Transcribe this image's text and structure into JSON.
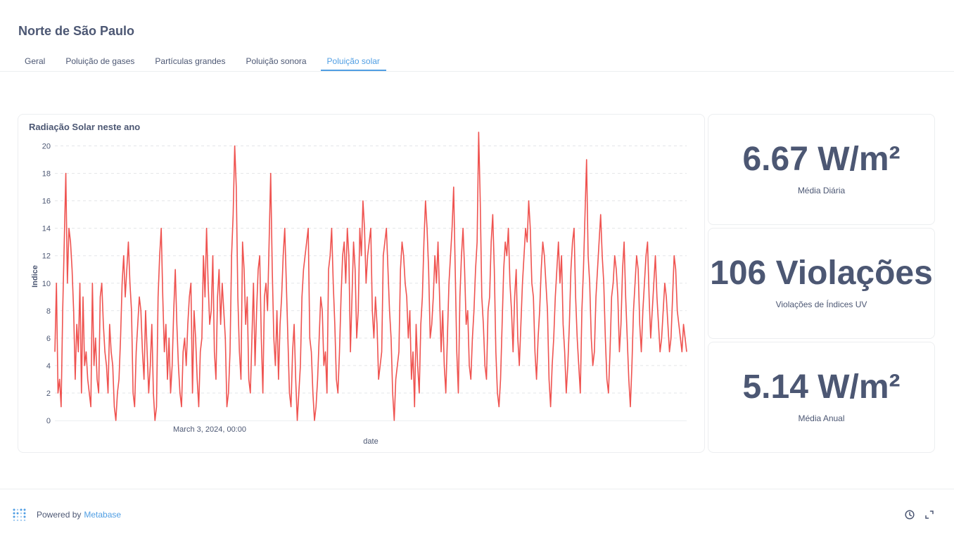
{
  "dashboard": {
    "title": "Norte de São Paulo",
    "tabs": [
      {
        "label": "Geral",
        "active": false
      },
      {
        "label": "Poluição de gases",
        "active": false
      },
      {
        "label": "Partículas grandes",
        "active": false
      },
      {
        "label": "Poluição sonora",
        "active": false
      },
      {
        "label": "Poluição solar",
        "active": true
      }
    ]
  },
  "chart_card": {
    "title": "Radiação Solar neste ano"
  },
  "chart_data": {
    "type": "line",
    "title": "Radiação Solar neste ano",
    "xlabel": "date",
    "ylabel": "Indice",
    "x_tick_labels": [
      "March 3, 2024, 00:00"
    ],
    "ylim": [
      0,
      21
    ],
    "y_ticks": [
      0,
      2,
      4,
      6,
      8,
      10,
      12,
      14,
      16,
      18,
      20
    ],
    "grid": true,
    "color": "#ef5350",
    "series": [
      {
        "values": [
          5,
          10,
          2,
          3,
          1,
          8,
          13,
          18,
          10,
          14,
          13,
          11,
          8,
          3,
          7,
          5,
          10,
          2,
          9,
          4,
          5,
          3,
          2,
          1,
          10,
          4,
          6,
          3,
          2,
          9,
          10,
          7,
          5,
          4,
          2,
          7,
          5,
          4,
          1,
          0,
          2,
          3,
          6,
          10,
          12,
          9,
          11,
          13,
          10,
          8,
          2,
          1,
          5,
          7,
          9,
          8,
          5,
          3,
          8,
          5,
          2,
          4,
          7,
          2,
          0,
          1,
          9,
          12,
          14,
          9,
          5,
          7,
          3,
          6,
          2,
          4,
          8,
          11,
          7,
          4,
          2,
          1,
          5,
          6,
          4,
          7,
          9,
          10,
          2,
          8,
          6,
          3,
          1,
          5,
          6,
          12,
          9,
          14,
          10,
          7,
          8,
          12,
          5,
          3,
          9,
          11,
          7,
          10,
          8,
          6,
          1,
          2,
          5,
          12,
          15,
          20,
          17,
          9,
          5,
          3,
          13,
          11,
          7,
          9,
          3,
          2,
          6,
          10,
          4,
          8,
          11,
          12,
          6,
          2,
          9,
          10,
          8,
          13,
          18,
          11,
          6,
          4,
          8,
          3,
          7,
          9,
          12,
          14,
          10,
          6,
          2,
          1,
          5,
          7,
          3,
          0,
          2,
          4,
          9,
          11,
          12,
          13,
          14,
          6,
          5,
          2,
          0,
          1,
          3,
          6,
          9,
          8,
          4,
          5,
          2,
          11,
          12,
          14,
          10,
          7,
          3,
          2,
          5,
          9,
          12,
          13,
          10,
          14,
          12,
          5,
          9,
          13,
          11,
          6,
          8,
          14,
          12,
          16,
          14,
          10,
          12,
          13,
          14,
          8,
          6,
          9,
          7,
          3,
          4,
          5,
          12,
          13,
          14,
          11,
          8,
          6,
          2,
          0,
          3,
          4,
          5,
          11,
          13,
          12,
          10,
          9,
          6,
          8,
          3,
          5,
          1,
          7,
          4,
          2,
          7,
          9,
          13,
          16,
          14,
          11,
          6,
          7,
          9,
          12,
          10,
          13,
          9,
          5,
          8,
          4,
          2,
          6,
          10,
          12,
          14,
          17,
          11,
          5,
          2,
          9,
          12,
          14,
          11,
          7,
          8,
          4,
          3,
          6,
          8,
          11,
          13,
          21,
          16,
          9,
          7,
          4,
          3,
          8,
          9,
          13,
          15,
          11,
          5,
          2,
          1,
          3,
          7,
          11,
          13,
          12,
          14,
          10,
          8,
          5,
          9,
          11,
          6,
          4,
          7,
          10,
          12,
          14,
          13,
          16,
          14,
          10,
          9,
          5,
          3,
          6,
          8,
          11,
          13,
          12,
          10,
          8,
          3,
          1,
          4,
          6,
          9,
          11,
          13,
          10,
          12,
          7,
          5,
          2,
          4,
          7,
          11,
          13,
          14,
          9,
          6,
          4,
          2,
          8,
          11,
          15,
          19,
          12,
          10,
          6,
          4,
          5,
          9,
          11,
          13,
          15,
          12,
          10,
          6,
          3,
          2,
          5,
          9,
          10,
          12,
          11,
          9,
          5,
          7,
          11,
          13,
          9,
          6,
          3,
          1,
          4,
          8,
          10,
          12,
          11,
          7,
          5,
          8,
          10,
          12,
          13,
          9,
          6,
          8,
          10,
          12,
          9,
          7,
          5,
          6,
          8,
          10,
          9,
          7,
          5,
          6,
          9,
          12,
          11,
          8,
          7,
          6,
          5,
          7,
          6,
          5
        ]
      }
    ]
  },
  "scalars": [
    {
      "value": "6.67 W/m²",
      "label": "Média Diária"
    },
    {
      "value": "106 Violações",
      "label": "Violações de Índices UV"
    },
    {
      "value": "5.14 W/m²",
      "label": "Média Anual"
    }
  ],
  "footer": {
    "powered_by": "Powered by",
    "brand": "Metabase"
  },
  "icons": {
    "logo": "metabase-logo-icon",
    "clock": "clock-icon",
    "fullscreen": "expand-icon"
  }
}
